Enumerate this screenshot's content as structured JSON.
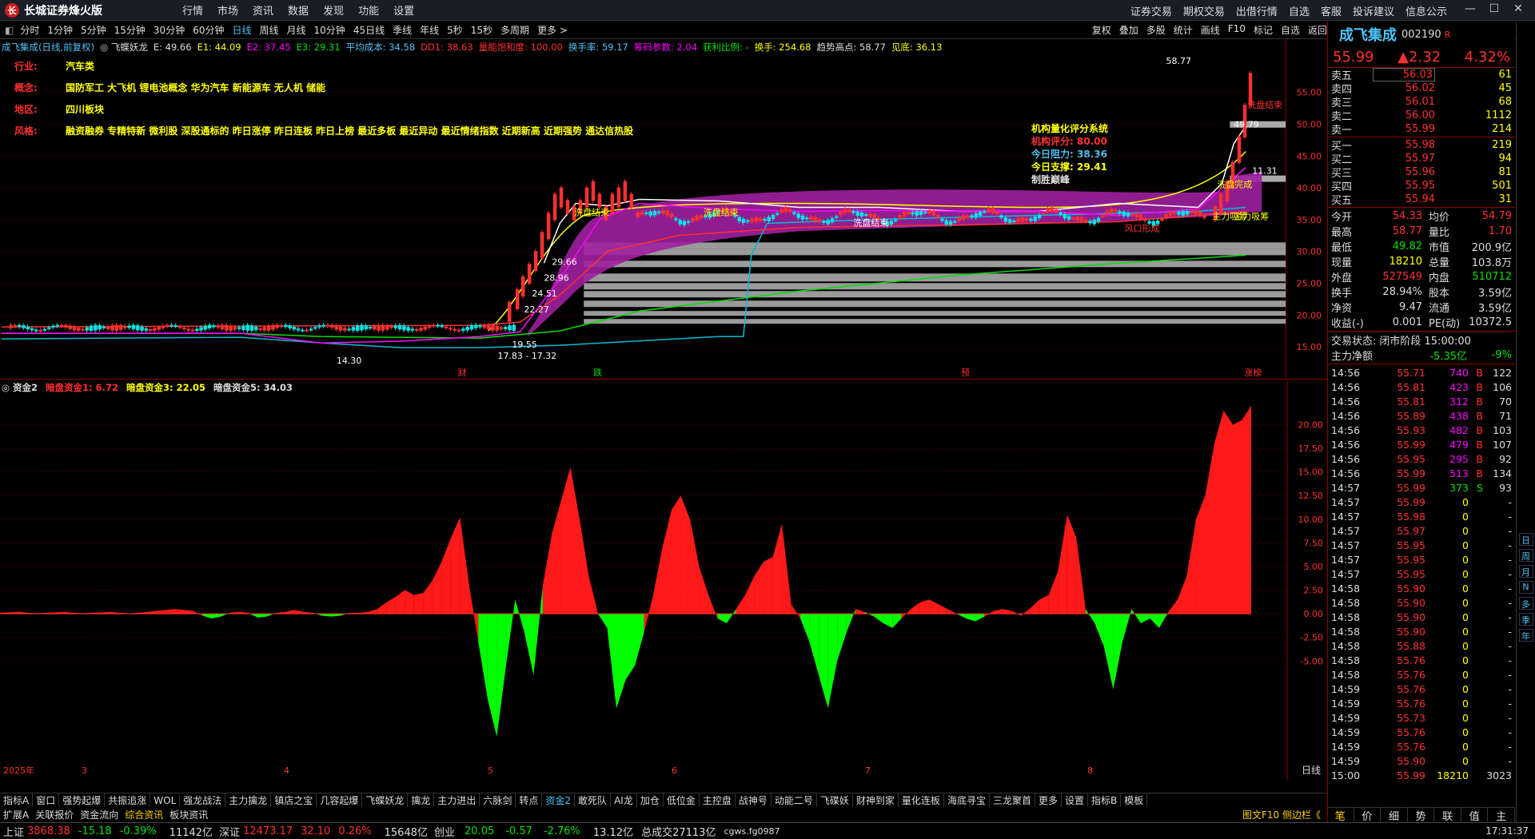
{
  "app": {
    "title": "长城证券烽火版",
    "menu": [
      "行情",
      "市场",
      "资讯",
      "数据",
      "发现",
      "功能",
      "设置"
    ],
    "right_menu": [
      "证券交易",
      "期权交易",
      "出借行情",
      "自选",
      "客服",
      "投诉建议",
      "信息公示"
    ]
  },
  "periods": [
    "分时",
    "1分钟",
    "5分钟",
    "15分钟",
    "30分钟",
    "60分钟",
    "日线",
    "周线",
    "月线",
    "10分钟",
    "45日线",
    "季线",
    "年线",
    "5秒",
    "15秒",
    "多周期",
    "更多 >"
  ],
  "active_period": "日线",
  "toolbar_right": [
    "复权",
    "叠加",
    "多股",
    "统计",
    "画线",
    "F10",
    "标记",
    "自选",
    "返回"
  ],
  "kline_legend": [
    {
      "text": "成飞集成(日线,前复权)",
      "color": "#4fc3f7"
    },
    {
      "text": "◎ 飞蝶妖龙",
      "color": "#ddd"
    },
    {
      "text": "E: 49.66",
      "color": "#ddd"
    },
    {
      "text": "E1: 44.09",
      "color": "#ffff00"
    },
    {
      "text": "E2: 37.45",
      "color": "#ff00ff"
    },
    {
      "text": "E3: 29.31",
      "color": "#00e000"
    },
    {
      "text": "平均成本: 34.58",
      "color": "#4fc3f7"
    },
    {
      "text": "DD1: 38.63",
      "color": "#ff3030"
    },
    {
      "text": "量能饱和度: 100.00",
      "color": "#ff3030"
    },
    {
      "text": "换手率: 59.17",
      "color": "#4fc3f7"
    },
    {
      "text": "筹码参数: 2.04",
      "color": "#ff00ff"
    },
    {
      "text": "获利比例: -",
      "color": "#00e000"
    },
    {
      "text": "换手: 254.68",
      "color": "#ffff00"
    },
    {
      "text": "趋势高点: 58.77",
      "color": "#ddd"
    },
    {
      "text": "见底: 36.13",
      "color": "#ffff00"
    }
  ],
  "info": {
    "industry_label": "行业:",
    "industry": "汽车类",
    "concept_label": "概念:",
    "concept": "国防军工 大飞机 锂电池概念 华为汽车 新能源车 无人机 储能",
    "region_label": "地区:",
    "region": "四川板块",
    "style_label": "风格:",
    "style": "融资融券 专精特新 微利股 深股通标的 昨日涨停 昨日连板 昨日上榜 最近多板 最近异动 最近情绪指数 近期新高 近期强势 通达信热股"
  },
  "rating": {
    "title": "机构量化评分系统",
    "score_label": "机构评分:",
    "score": "80.00",
    "resist_label": "今日阻力:",
    "resist": "38.36",
    "support_label": "今日支撑:",
    "support": "29.41",
    "conclusion": "制胜巅峰"
  },
  "price_axis": [
    "55.00",
    "50.00",
    "45.00",
    "40.00",
    "35.00",
    "30.00",
    "25.00",
    "20.00",
    "15.00"
  ],
  "kline_annotations": {
    "high": "58.77",
    "low": "14.30",
    "mid1": "29.66",
    "mid2": "28.96",
    "mid3": "24.51",
    "mid4": "22.27",
    "low2": "17.83 - 17.32",
    "low3": "19.55",
    "v1": "49.79",
    "v2": "11.31"
  },
  "kline_signals": [
    "洗盘结束",
    "洗盘结束",
    "洗盘结束",
    "风口形成",
    "主力吸筹",
    "洗盘完成",
    "主力吸筹",
    "洗盘结束"
  ],
  "event_markers": [
    "财",
    "跌",
    "预",
    "涨榜"
  ],
  "fund_legend": [
    {
      "text": "◎ 资金2",
      "color": "#ddd"
    },
    {
      "text": "暗盘资金1: 6.72",
      "color": "#ff3030"
    },
    {
      "text": "暗盘资金3: 22.05",
      "color": "#ffff00"
    },
    {
      "text": "暗盘资金5: 34.03",
      "color": "#ddd"
    }
  ],
  "fund_axis": [
    "20.00",
    "17.50",
    "15.00",
    "12.50",
    "10.00",
    "7.50",
    "5.00",
    "2.50",
    "0.00",
    "-2.50",
    "-5.00"
  ],
  "x_axis": [
    "2025年",
    "3",
    "4",
    "5",
    "6",
    "7",
    "8"
  ],
  "x_axis_right": "日线",
  "tabs1": [
    "指标A",
    "窗口",
    "强势起爆",
    "共振追涨",
    "WOL",
    "强龙战法",
    "主力擒龙",
    "镇店之宝",
    "几容起爆",
    "飞蝶妖龙",
    "擒龙",
    "主力进出",
    "六脉剑",
    "转点",
    "资金2",
    "敢死队",
    "AI龙",
    "加仓",
    "低位金",
    "主控盘",
    "战神号",
    "动能二号",
    "飞碟妖",
    "财神到家",
    "量化连板",
    "海底寻宝",
    "三龙聚首",
    "更多",
    "设置",
    "指标B",
    "模板"
  ],
  "active_tab1": "资金2",
  "tabs2": [
    "扩展A",
    "关联报价",
    "资金流向",
    "综合资讯",
    "板块资讯"
  ],
  "tabs2_right": "图文F10 侧边栏《",
  "status": {
    "sh_name": "上证",
    "sh_idx": "3868.38",
    "sh_chg": "-15.18",
    "sh_pct": "-0.39%",
    "sh_amt": "11142亿",
    "sz_name": "深证",
    "sz_idx": "12473.17",
    "sz_chg": "32.10",
    "sz_pct": "0.26%",
    "sz_amt": "15648亿",
    "cy_name": "创业",
    "cy_idx": "20.05",
    "cy_chg": "-0.57",
    "cy_pct": "-2.76%",
    "cy_amt": "13.12亿",
    "total": "总成交27113亿",
    "server": "cgws.fg0987",
    "time": "17:31:37"
  },
  "stock": {
    "name": "成飞集成",
    "code": "002190",
    "flag": "R",
    "price": "55.99",
    "change": "▲2.32",
    "pct": "4.32%"
  },
  "order_book": {
    "asks": [
      {
        "n": "卖五",
        "p": "56.03",
        "v": "61"
      },
      {
        "n": "卖四",
        "p": "56.02",
        "v": "45"
      },
      {
        "n": "卖三",
        "p": "56.01",
        "v": "68"
      },
      {
        "n": "卖二",
        "p": "56.00",
        "v": "1112"
      },
      {
        "n": "卖一",
        "p": "55.99",
        "v": "214"
      }
    ],
    "bids": [
      {
        "n": "买一",
        "p": "55.98",
        "v": "219"
      },
      {
        "n": "买二",
        "p": "55.97",
        "v": "94"
      },
      {
        "n": "买三",
        "p": "55.96",
        "v": "81"
      },
      {
        "n": "买四",
        "p": "55.95",
        "v": "501"
      },
      {
        "n": "买五",
        "p": "55.94",
        "v": "31"
      }
    ]
  },
  "quote": [
    {
      "k1": "今开",
      "v1": "54.33",
      "c1": "red",
      "k2": "均价",
      "v2": "54.79",
      "c2": "red"
    },
    {
      "k1": "最高",
      "v1": "58.77",
      "c1": "red",
      "k2": "量比",
      "v2": "1.70",
      "c2": "red"
    },
    {
      "k1": "最低",
      "v1": "49.82",
      "c1": "green",
      "k2": "市值",
      "v2": "200.9亿",
      "c2": "white"
    },
    {
      "k1": "现量",
      "v1": "18210",
      "c1": "yellow",
      "k2": "总量",
      "v2": "103.8万",
      "c2": "white"
    },
    {
      "k1": "外盘",
      "v1": "527549",
      "c1": "red",
      "k2": "内盘",
      "v2": "510712",
      "c2": "green"
    },
    {
      "k1": "换手",
      "v1": "28.94%",
      "c1": "white",
      "k2": "股本",
      "v2": "3.59亿",
      "c2": "white"
    },
    {
      "k1": "净资",
      "v1": "9.47",
      "c1": "white",
      "k2": "流通",
      "v2": "3.59亿",
      "c2": "white"
    },
    {
      "k1": "收益(-)",
      "v1": "0.001",
      "c1": "white",
      "k2": "PE(动)",
      "v2": "10372.5",
      "c2": "white"
    }
  ],
  "trade_status_label": "交易状态:",
  "trade_status": "闭市阶段 15:00:00",
  "main_net_label": "主力净额",
  "main_net": "-5.35亿",
  "main_net_pct": "-9%",
  "ticks": [
    {
      "t": "14:56",
      "p": "55.71",
      "v": "740",
      "bs": "B",
      "c": "122"
    },
    {
      "t": "14:56",
      "p": "55.81",
      "v": "423",
      "bs": "B",
      "c": "106"
    },
    {
      "t": "14:56",
      "p": "55.81",
      "v": "312",
      "bs": "B",
      "c": "70"
    },
    {
      "t": "14:56",
      "p": "55.89",
      "v": "438",
      "bs": "B",
      "c": "71"
    },
    {
      "t": "14:56",
      "p": "55.93",
      "v": "482",
      "bs": "B",
      "c": "103"
    },
    {
      "t": "14:56",
      "p": "55.99",
      "v": "479",
      "bs": "B",
      "c": "107"
    },
    {
      "t": "14:56",
      "p": "55.95",
      "v": "295",
      "bs": "B",
      "c": "92"
    },
    {
      "t": "14:56",
      "p": "55.99",
      "v": "513",
      "bs": "B",
      "c": "134"
    },
    {
      "t": "14:57",
      "p": "55.99",
      "v": "373",
      "bs": "S",
      "c": "93"
    },
    {
      "t": "14:57",
      "p": "55.99",
      "v": "0",
      "bs": "",
      "c": "-"
    },
    {
      "t": "14:57",
      "p": "55.98",
      "v": "0",
      "bs": "",
      "c": "-"
    },
    {
      "t": "14:57",
      "p": "55.97",
      "v": "0",
      "bs": "",
      "c": "-"
    },
    {
      "t": "14:57",
      "p": "55.95",
      "v": "0",
      "bs": "",
      "c": "-"
    },
    {
      "t": "14:57",
      "p": "55.95",
      "v": "0",
      "bs": "",
      "c": "-"
    },
    {
      "t": "14:57",
      "p": "55.95",
      "v": "0",
      "bs": "",
      "c": "-"
    },
    {
      "t": "14:58",
      "p": "55.90",
      "v": "0",
      "bs": "",
      "c": "-"
    },
    {
      "t": "14:58",
      "p": "55.90",
      "v": "0",
      "bs": "",
      "c": "-"
    },
    {
      "t": "14:58",
      "p": "55.90",
      "v": "0",
      "bs": "",
      "c": "-"
    },
    {
      "t": "14:58",
      "p": "55.90",
      "v": "0",
      "bs": "",
      "c": "-"
    },
    {
      "t": "14:58",
      "p": "55.88",
      "v": "0",
      "bs": "",
      "c": "-"
    },
    {
      "t": "14:58",
      "p": "55.76",
      "v": "0",
      "bs": "",
      "c": "-"
    },
    {
      "t": "14:58",
      "p": "55.76",
      "v": "0",
      "bs": "",
      "c": "-"
    },
    {
      "t": "14:59",
      "p": "55.76",
      "v": "0",
      "bs": "",
      "c": "-"
    },
    {
      "t": "14:59",
      "p": "55.76",
      "v": "0",
      "bs": "",
      "c": "-"
    },
    {
      "t": "14:59",
      "p": "55.73",
      "v": "0",
      "bs": "",
      "c": "-"
    },
    {
      "t": "14:59",
      "p": "55.76",
      "v": "0",
      "bs": "",
      "c": "-"
    },
    {
      "t": "14:59",
      "p": "55.76",
      "v": "0",
      "bs": "",
      "c": "-"
    },
    {
      "t": "14:59",
      "p": "55.90",
      "v": "0",
      "bs": "",
      "c": "-"
    },
    {
      "t": "15:00",
      "p": "55.99",
      "v": "18210",
      "bs": "",
      "c": "3023"
    }
  ],
  "right_tabs": [
    "笔",
    "价",
    "细",
    "势",
    "联",
    "值",
    "主"
  ],
  "side_strip": [
    "日",
    "周",
    "月",
    "N",
    "多",
    "季",
    "年"
  ],
  "fund_values": [
    0.1,
    0.15,
    0.2,
    0.1,
    0.05,
    0.1,
    0.15,
    0.2,
    0.1,
    0.05,
    0.1,
    0.15,
    0.2,
    0.1,
    0.05,
    0.1,
    0.2,
    0.3,
    0.4,
    0.5,
    0.4,
    0.3,
    -0.2,
    -0.5,
    -0.3,
    0.1,
    0.2,
    0.1,
    -0.4,
    -0.3,
    0.1,
    0.2,
    0.4,
    0.2,
    0.1,
    -0.2,
    -0.3,
    -0.2,
    0.1,
    0.1,
    0.2,
    0.5,
    1.2,
    1.8,
    2.5,
    2.0,
    2.2,
    3.5,
    5.5,
    8.0,
    10.2,
    3.0,
    -3.0,
    -9.0,
    -13.0,
    -5.5,
    1.5,
    -2.0,
    -6.5,
    3.0,
    8.5,
    12.0,
    15.5,
    10.0,
    4.0,
    0.0,
    -1.5,
    -10.0,
    -7.0,
    -5.5,
    -2.0,
    2.0,
    7.0,
    11.0,
    12.5,
    10.0,
    5.0,
    2.0,
    -0.5,
    -1.0,
    0.5,
    2.0,
    4.0,
    5.5,
    6.0,
    9.5,
    1.0,
    -0.5,
    -3.0,
    -6.5,
    -10.0,
    -5.0,
    -2.0,
    0.5,
    0.2,
    -0.3,
    -1.0,
    -1.5,
    -0.5,
    0.5,
    1.2,
    1.5,
    1.0,
    0.5,
    0.0,
    -0.5,
    -0.8,
    -0.3,
    0.3,
    0.5,
    0.3,
    -0.2,
    0.6,
    1.5,
    2.0,
    4.5,
    10.5,
    8.0,
    0.5,
    -1.0,
    -3.5,
    -8.0,
    -3.0,
    0.5,
    -1.0,
    -0.5,
    -1.5,
    0.2,
    1.5,
    4.0,
    10.0,
    12.5,
    18.0,
    21.5,
    20.0,
    20.5,
    22.0
  ]
}
